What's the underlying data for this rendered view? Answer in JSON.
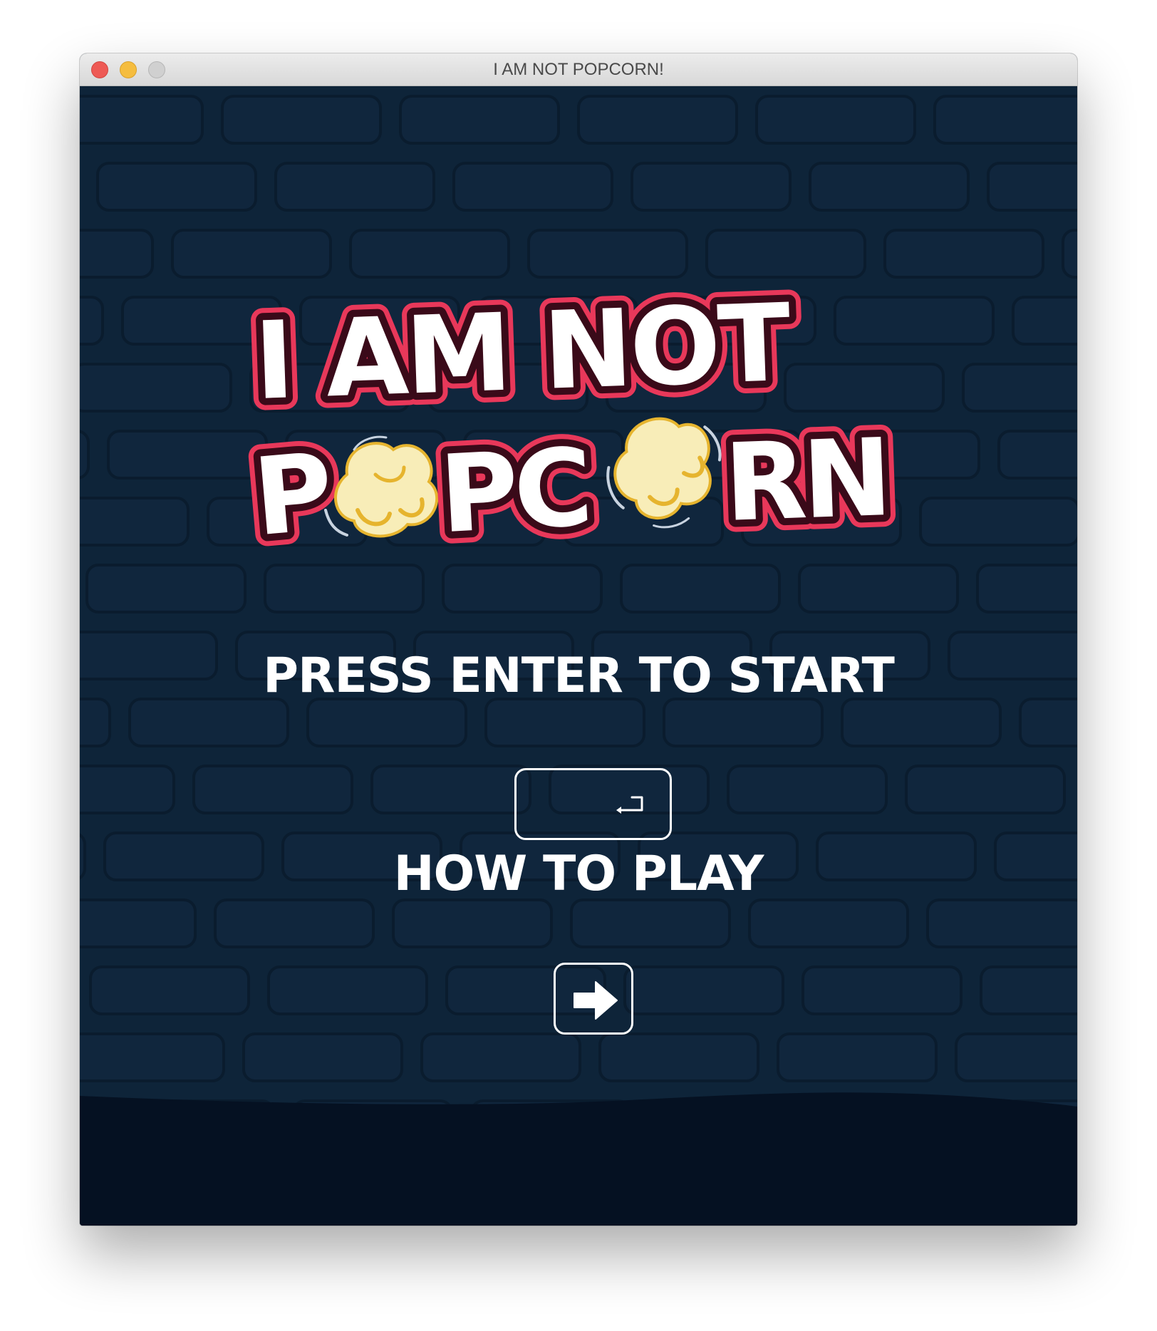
{
  "window": {
    "title": "I AM NOT POPCORN!"
  },
  "logo": {
    "line1": "I AM NOT",
    "line2": "POPCORN"
  },
  "menu": {
    "start_label": "PRESS ENTER TO START",
    "start_key_icon": "enter-key-icon",
    "howto_label": "HOW TO PLAY",
    "howto_key_icon": "right-arrow-icon"
  },
  "colors": {
    "background": "#0e2439",
    "brick": "#10263d",
    "brick_outline": "#0a1c2e",
    "ground": "#051122",
    "logo_fill": "#ffffff",
    "logo_inner_stroke": "#3a0a19",
    "logo_outer_stroke": "#e8385a",
    "popcorn": "#f8edb8",
    "popcorn_shadow": "#e6b42e"
  }
}
